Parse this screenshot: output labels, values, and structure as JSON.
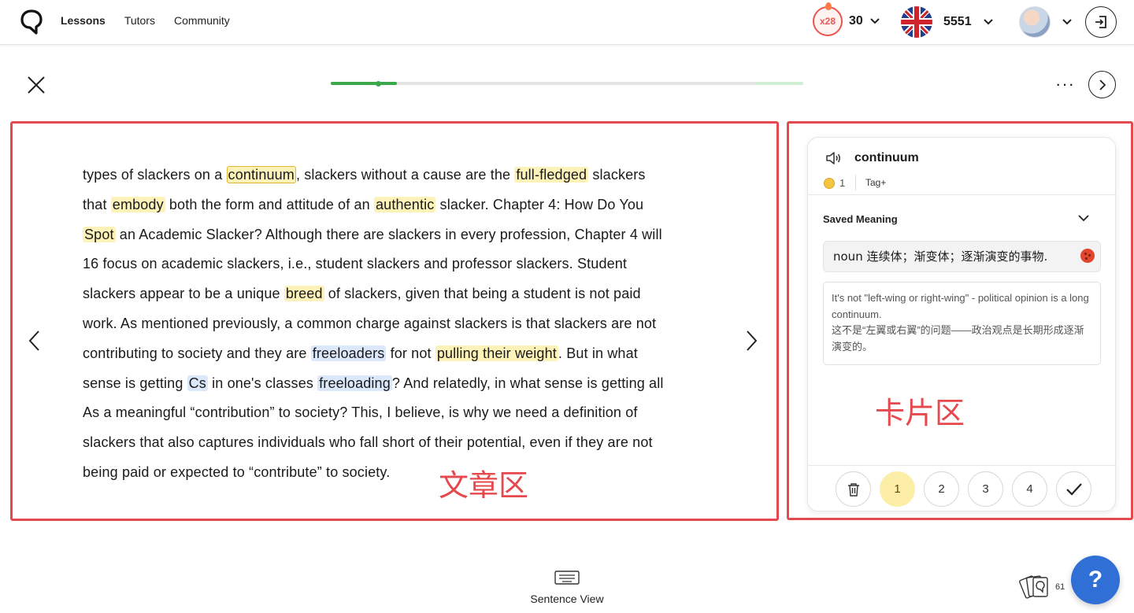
{
  "nav": {
    "links": [
      "Lessons",
      "Tutors",
      "Community"
    ],
    "streak_badge": "x28",
    "streak_count": "30",
    "coins": "5551"
  },
  "lesson": {
    "progress_fraction": 0.14,
    "more_label": "···"
  },
  "article": {
    "lines": [
      [
        {
          "t": "types of slackers on a "
        },
        {
          "t": "continuum",
          "h": "yb"
        },
        {
          "t": ", slackers without a cause are the "
        },
        {
          "t": "full-fledged",
          "h": "y"
        },
        {
          "t": " slackers"
        }
      ],
      [
        {
          "t": "that "
        },
        {
          "t": "embody",
          "h": "y"
        },
        {
          "t": " both the form and attitude of an "
        },
        {
          "t": "authentic",
          "h": "y"
        },
        {
          "t": " slacker.  Chapter 4: How Do You"
        }
      ],
      [
        {
          "t": "Spot",
          "h": "y"
        },
        {
          "t": " an Academic Slacker?  Although there are slackers in every profession, Chapter 4 will"
        }
      ],
      [
        {
          "t": "16 focus on academic slackers, i.e., student slackers and professor slackers.  Student"
        }
      ],
      [
        {
          "t": "slackers appear to be a unique "
        },
        {
          "t": "breed",
          "h": "y"
        },
        {
          "t": " of slackers, given that being a student is not paid"
        }
      ],
      [
        {
          "t": "work.  As mentioned previously, a common charge against slackers is that slackers are not"
        }
      ],
      [
        {
          "t": "contributing to society and they are "
        },
        {
          "t": "freeloaders",
          "h": "b"
        },
        {
          "t": " for not "
        },
        {
          "t": "pulling their weight",
          "h": "y"
        },
        {
          "t": ".  But in what"
        }
      ],
      [
        {
          "t": "sense is getting "
        },
        {
          "t": "Cs",
          "h": "b"
        },
        {
          "t": " in one's classes "
        },
        {
          "t": "freeloading",
          "h": "b"
        },
        {
          "t": "?  And relatedly, in what sense is getting all"
        }
      ],
      [
        {
          "t": "As a meaningful “contribution” to society?  This, I believe, is why we need a definition of"
        }
      ],
      [
        {
          "t": "slackers that also captures individuals who fall short of their potential, even if they are not"
        }
      ],
      [
        {
          "t": "being paid or expected to “contribute” to society."
        }
      ]
    ],
    "zone_label": "文章区"
  },
  "card": {
    "word": "continuum",
    "level": "1",
    "tag_label": "Tag+",
    "saved_meaning_label": "Saved Meaning",
    "meaning": "noun 连续体；渐变体；逐渐演变的事物.",
    "example_en": "It's not \"left-wing or right-wing\" - political opinion is a long continuum.",
    "example_zh": "这不是“左翼或右翼”的问题——政治观点是长期形成逐渐演变的。",
    "zone_label": "卡片区",
    "ratings": [
      "1",
      "2",
      "3",
      "4"
    ],
    "active_rating": "1"
  },
  "footer": {
    "sentence_view_label": "Sentence View",
    "deck_count": "61",
    "help_label": "?"
  },
  "colors": {
    "annotation_red": "#e5484d",
    "progress_green": "#3aa84a",
    "highlight_yellow": "#fdf2b8",
    "highlight_blue": "#dbe7fb",
    "help_blue": "#2f6fd6"
  }
}
